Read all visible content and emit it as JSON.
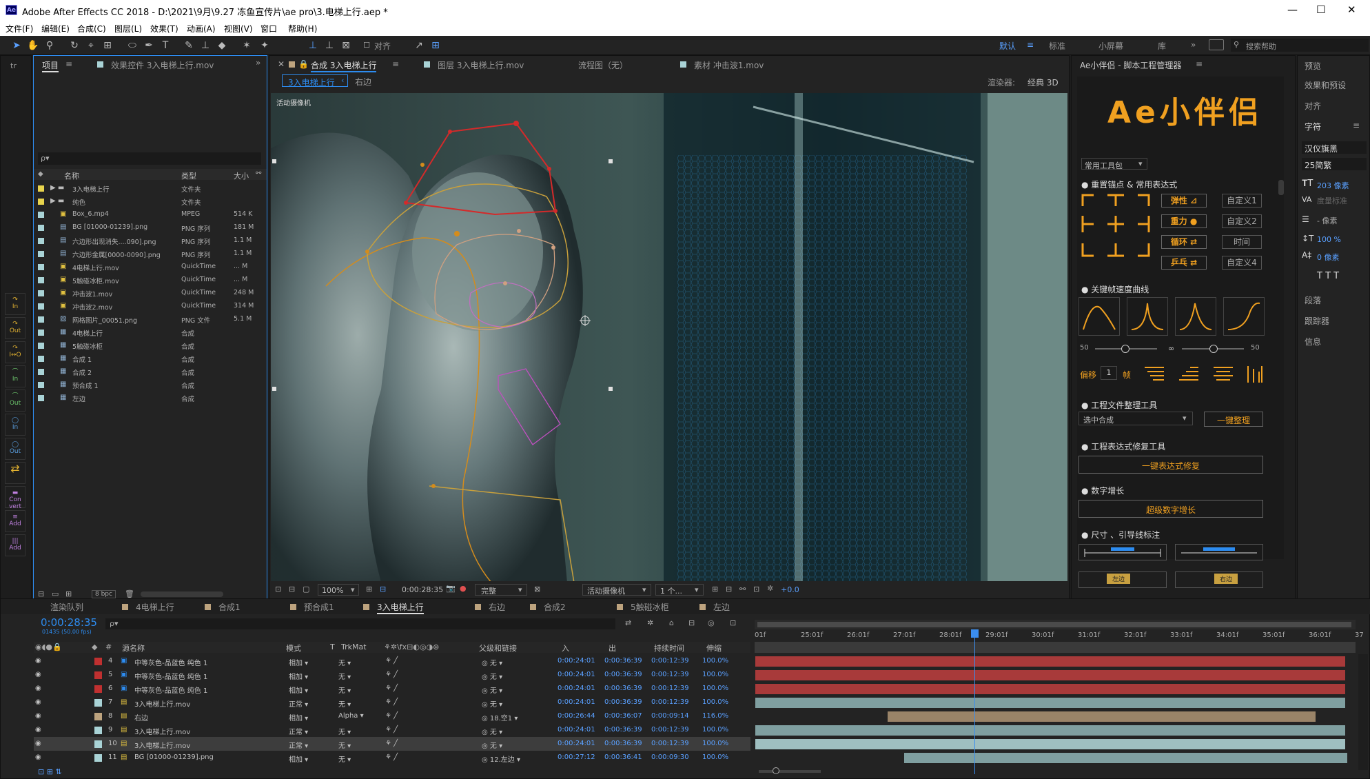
{
  "app": {
    "title": "Adobe After Effects CC 2018 - D:\\2021\\9月\\9.27 冻鱼宣传片\\ae pro\\3.电梯上行.aep *",
    "logo": "Ae",
    "minimize": "—",
    "maximize": "☐",
    "close": "✕"
  },
  "menu": [
    "文件(F)",
    "编辑(E)",
    "合成(C)",
    "图层(L)",
    "效果(T)",
    "动画(A)",
    "视图(V)",
    "窗口",
    "帮助(H)"
  ],
  "toolbar": {
    "align_label": "对齐",
    "workspaces": [
      "默认",
      "标准",
      "小屏幕",
      "库"
    ],
    "search_placeholder": "搜索帮助"
  },
  "left_strip": {
    "tab": "tr",
    "buttons": [
      "In",
      "Out",
      "I↔O",
      "In",
      "Out",
      "In",
      "Out",
      "",
      "Con vert",
      "Add",
      "Add"
    ]
  },
  "project": {
    "tab": "项目",
    "effects_tab": "效果控件 3入电梯上行.mov",
    "search_placeholder": "ρ▾",
    "columns": [
      "名称",
      "类型",
      "大小"
    ],
    "items": [
      {
        "name": "3入电梯上行",
        "type": "文件夹",
        "size": "",
        "color": "#e8d44d",
        "icon": "folder"
      },
      {
        "name": "纯色",
        "type": "文件夹",
        "size": "",
        "color": "#e8d44d",
        "icon": "folder"
      },
      {
        "name": "Box_6.mp4",
        "type": "MPEG",
        "size": "514 K",
        "color": "#a9d3d6",
        "icon": "video"
      },
      {
        "name": "BG [01000-01239].png",
        "type": "PNG 序列",
        "size": "181 M",
        "color": "#a9d3d6",
        "icon": "seq"
      },
      {
        "name": "六边形出现消失....090].png",
        "type": "PNG 序列",
        "size": "1.1 M",
        "color": "#a9d3d6",
        "icon": "seq"
      },
      {
        "name": "六边形金属[0000-0090].png",
        "type": "PNG 序列",
        "size": "1.1 M",
        "color": "#a9d3d6",
        "icon": "seq"
      },
      {
        "name": "4电梯上行.mov",
        "type": "QuickTime",
        "size": "... M",
        "color": "#a9d3d6",
        "icon": "video"
      },
      {
        "name": "5触碰冰柜.mov",
        "type": "QuickTime",
        "size": "... M",
        "color": "#a9d3d6",
        "icon": "video"
      },
      {
        "name": "冲击波1.mov",
        "type": "QuickTime",
        "size": "248 M",
        "color": "#a9d3d6",
        "icon": "video"
      },
      {
        "name": "冲击波2.mov",
        "type": "QuickTime",
        "size": "314 M",
        "color": "#a9d3d6",
        "icon": "video"
      },
      {
        "name": "网格图片_00051.png",
        "type": "PNG 文件",
        "size": "5.1 M",
        "color": "#a9d3d6",
        "icon": "img"
      },
      {
        "name": "4电梯上行",
        "type": "合成",
        "size": "",
        "color": "#a9d3d6",
        "icon": "comp"
      },
      {
        "name": "5触碰冰柜",
        "type": "合成",
        "size": "",
        "color": "#a9d3d6",
        "icon": "comp"
      },
      {
        "name": "合成 1",
        "type": "合成",
        "size": "",
        "color": "#a9d3d6",
        "icon": "comp"
      },
      {
        "name": "合成 2",
        "type": "合成",
        "size": "",
        "color": "#a9d3d6",
        "icon": "comp"
      },
      {
        "name": "预合成 1",
        "type": "合成",
        "size": "",
        "color": "#a9d3d6",
        "icon": "comp"
      },
      {
        "name": "左边",
        "type": "合成",
        "size": "",
        "color": "#a9d3d6",
        "icon": "comp"
      }
    ],
    "bpc": "8 bpc"
  },
  "viewer": {
    "tabs": [
      "合成 3入电梯上行",
      "图层 3入电梯上行.mov",
      "流程图（无）",
      "素材 冲击波1.mov"
    ],
    "breadcrumbs": [
      "3入电梯上行",
      "右边"
    ],
    "renderer_label": "渲染器:",
    "renderer": "经典 3D",
    "camera_label": "活动摄像机",
    "zoom": "100%",
    "timecode": "0:00:28:35",
    "quality": "完整",
    "view": "活动摄像机",
    "views": "1 个...",
    "exposure": "+0.0"
  },
  "helper": {
    "tab": "Ae小伴侣 - 脚本工程管理器",
    "title": "Ae小伴侣",
    "toolpack": "常用工具包",
    "sec_anchor": "重置锚点 & 常用表达式",
    "expr_buttons": [
      "弹性",
      "重力",
      "循环",
      "乒乓"
    ],
    "custom_buttons": [
      "自定义1",
      "自定义2",
      "时间",
      "自定义4"
    ],
    "sec_curve": "关键帧速度曲线",
    "slider_left": "50",
    "slider_right": "50",
    "offset_label": "偏移",
    "offset_value": "1",
    "frame_label": "帧",
    "sec_project": "工程文件整理工具",
    "select_value": "选中合成",
    "organize_btn": "一键整理",
    "sec_expr_fix": "工程表达式修复工具",
    "expr_fix_btn": "一键表达式修复",
    "sec_num": "数字增长",
    "num_btn": "超级数字增长",
    "sec_dims": "尺寸 、引导线标注",
    "left_label": "左边",
    "right_label": "右边"
  },
  "right_panel": {
    "items": [
      "预览",
      "效果和预设",
      "对齐",
      "字符"
    ],
    "font": "汉仪旗黑",
    "style": "25简繁",
    "size": "203 像素",
    "tracking_label": "度量标准",
    "leading": "- 像素",
    "vscale": "100 %",
    "baseline": "0 像素",
    "more": [
      "段落",
      "跟踪器",
      "信息"
    ]
  },
  "timeline": {
    "tabs": [
      "渲染队列",
      "4电梯上行",
      "合成1",
      "预合成1",
      "3入电梯上行",
      "右边",
      "合成2",
      "5触碰冰柜",
      "左边"
    ],
    "timecode": "0:00:28:35",
    "fps": "01435 (50.00 fps)",
    "headers": {
      "name": "源名称",
      "mode": "模式",
      "t": "T",
      "trkmat": "TrkMat",
      "parent": "父级和链接",
      "in": "入",
      "out": "出",
      "dur": "持续时间",
      "stretch": "伸缩"
    },
    "ruler": [
      "01f",
      "25:01f",
      "26:01f",
      "27:01f",
      "28:01f",
      "29:01f",
      "30:01f",
      "31:01f",
      "32:01f",
      "33:01f",
      "34:01f",
      "35:01f",
      "36:01f",
      "37"
    ],
    "layers": [
      {
        "num": "4",
        "name": "中等灰色-品蓝色 纯色 1",
        "mode": "相加",
        "trk": "无",
        "parent": "无",
        "in": "0:00:24:01",
        "out": "0:00:36:39",
        "dur": "0:00:12:39",
        "str": "100.0%",
        "color": "#c03030"
      },
      {
        "num": "5",
        "name": "中等灰色-品蓝色 纯色 1",
        "mode": "相加",
        "trk": "无",
        "parent": "无",
        "in": "0:00:24:01",
        "out": "0:00:36:39",
        "dur": "0:00:12:39",
        "str": "100.0%",
        "color": "#c03030"
      },
      {
        "num": "6",
        "name": "中等灰色-品蓝色 纯色 1",
        "mode": "相加",
        "trk": "无",
        "parent": "无",
        "in": "0:00:24:01",
        "out": "0:00:36:39",
        "dur": "0:00:12:39",
        "str": "100.0%",
        "color": "#c03030"
      },
      {
        "num": "7",
        "name": "3入电梯上行.mov",
        "mode": "正常",
        "trk": "无",
        "parent": "无",
        "in": "0:00:24:01",
        "out": "0:00:36:39",
        "dur": "0:00:12:39",
        "str": "100.0%",
        "color": "#a9d3d6"
      },
      {
        "num": "8",
        "name": "右边",
        "mode": "相加",
        "trk": "Alpha",
        "parent": "18.空1",
        "in": "0:00:26:44",
        "out": "0:00:36:07",
        "dur": "0:00:09:14",
        "str": "116.0%",
        "color": "#bda37e"
      },
      {
        "num": "9",
        "name": "3入电梯上行.mov",
        "mode": "正常",
        "trk": "无",
        "parent": "无",
        "in": "0:00:24:01",
        "out": "0:00:36:39",
        "dur": "0:00:12:39",
        "str": "100.0%",
        "color": "#a9d3d6"
      },
      {
        "num": "10",
        "name": "3入电梯上行.mov",
        "mode": "正常",
        "trk": "无",
        "parent": "无",
        "in": "0:00:24:01",
        "out": "0:00:36:39",
        "dur": "0:00:12:39",
        "str": "100.0%",
        "color": "#a9d3d6"
      },
      {
        "num": "11",
        "name": "BG [01000-01239].png",
        "mode": "相加",
        "trk": "无",
        "parent": "12.左边",
        "in": "0:00:27:12",
        "out": "0:00:36:41",
        "dur": "0:00:09:30",
        "str": "100.0%",
        "color": "#a9d3d6"
      }
    ]
  }
}
